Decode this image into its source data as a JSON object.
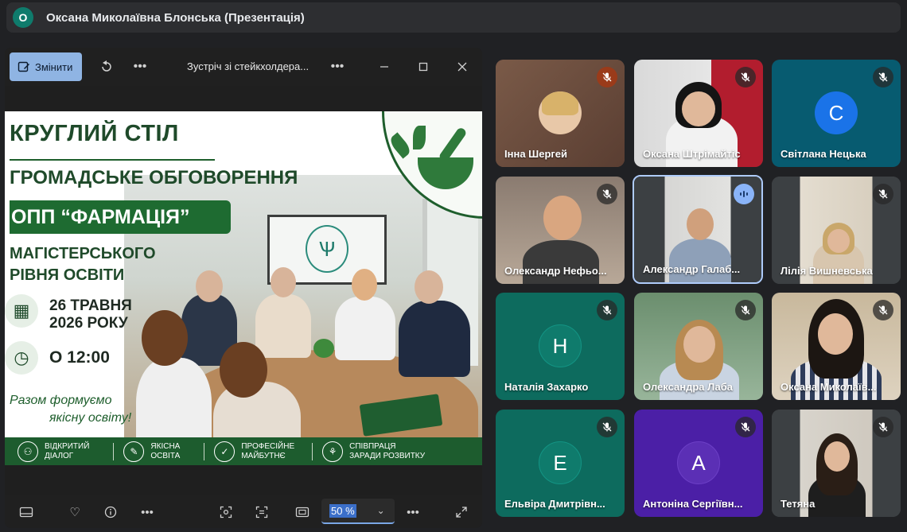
{
  "presenter": {
    "avatar_letter": "О",
    "title": "Оксана Миколаївна Блонська (Презентація)"
  },
  "window": {
    "edit_label": "Змінити",
    "title": "Зустріч зі стейкхолдера...",
    "zoom": "50 %"
  },
  "slide": {
    "line1": "КРУГЛИЙ СТІЛ",
    "line2": "ГРОМАДСЬКЕ ОБГОВОРЕННЯ",
    "line3": "ОПП “ФАРМАЦІЯ”",
    "line4a": "МАГІСТЕРСЬКОГО",
    "line4b": "РІВНЯ ОСВІТИ",
    "date1": "26 ТРАВНЯ",
    "date2": "2026 РОКУ",
    "time": "О 12:00",
    "slogan1": "Разом формуємо",
    "slogan2": "якісну освіту!",
    "footer": [
      {
        "l1": "ВІДКРИТИЙ",
        "l2": "ДІАЛОГ",
        "icon": "people-icon"
      },
      {
        "l1": "ЯКІСНА",
        "l2": "ОСВІТА",
        "icon": "graduation-icon"
      },
      {
        "l1": "ПРОФЕСІЙНЕ",
        "l2": "МАЙБУТНЄ",
        "icon": "shield-icon"
      },
      {
        "l1": "СПІВПРАЦЯ",
        "l2": "ЗАРАДИ РОЗВИТКУ",
        "icon": "handshake-icon"
      }
    ]
  },
  "participants": [
    {
      "name": "Інна Шергей",
      "muted": true
    },
    {
      "name": "Оксана Штрімайтіс",
      "muted": true
    },
    {
      "name": "Світлана Нецька",
      "muted": true,
      "letter": "С"
    },
    {
      "name": "Олександр Нефьо...",
      "muted": true
    },
    {
      "name": "Александр Галаб...",
      "muted": false,
      "speaking": true
    },
    {
      "name": "Лілія Вишневська",
      "muted": true
    },
    {
      "name": "Наталія Захарко",
      "muted": true,
      "letter": "Н"
    },
    {
      "name": "Олександра Лаба",
      "muted": true
    },
    {
      "name": "Оксана Миколаїв...",
      "muted": true
    },
    {
      "name": "Ельвіра Дмитрівн...",
      "muted": true,
      "letter": "Е"
    },
    {
      "name": "Антоніна Сергіївн...",
      "muted": true,
      "letter": "А"
    },
    {
      "name": "Тетяна",
      "muted": true
    }
  ],
  "colors": {
    "accent": "#8ab4f8",
    "teal": "#0f7b6c",
    "green": "#1e6b31",
    "purple": "#5b2fb5"
  }
}
